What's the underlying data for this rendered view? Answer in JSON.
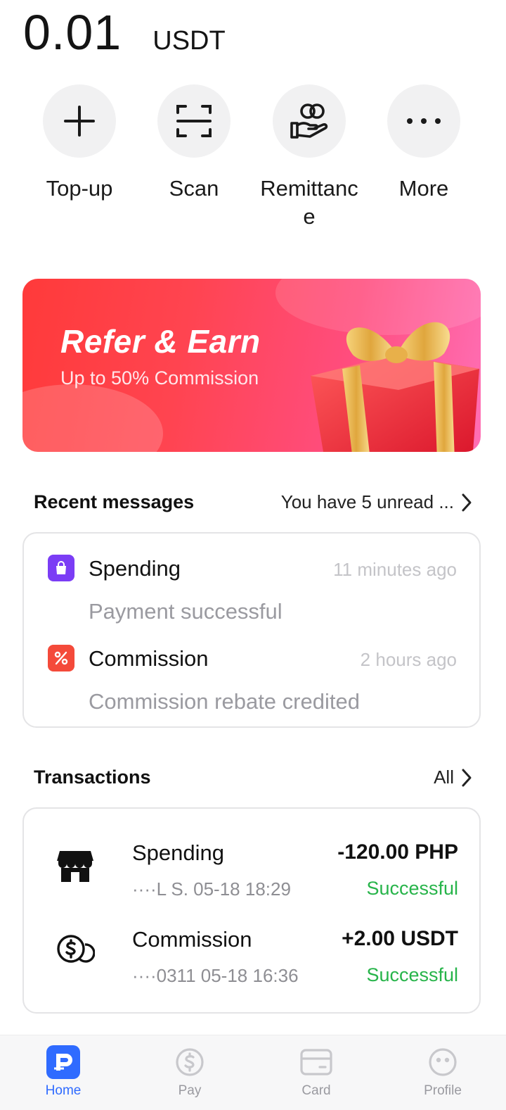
{
  "balance": {
    "amount": "0.01",
    "currency": "USDT"
  },
  "actions": [
    {
      "label": "Top-up",
      "icon": "plus-icon"
    },
    {
      "label": "Scan",
      "icon": "scan-icon"
    },
    {
      "label": "Remittance",
      "icon": "remittance-icon"
    },
    {
      "label": "More",
      "icon": "more-icon"
    }
  ],
  "banner": {
    "title": "Refer & Earn",
    "subtitle": "Up to 50% Commission"
  },
  "messages": {
    "title": "Recent messages",
    "link": "You have 5 unread ...",
    "items": [
      {
        "name": "Spending",
        "time": "11 minutes ago",
        "desc": "Payment successful",
        "icon": "shopping-bag-icon",
        "color": "#7b3df5"
      },
      {
        "name": "Commission",
        "time": "2 hours ago",
        "desc": "Commission rebate credited",
        "icon": "percent-icon",
        "color": "#f44a3a"
      }
    ]
  },
  "transactions": {
    "title": "Transactions",
    "link": "All",
    "items": [
      {
        "name": "Spending",
        "meta": "····L S.  05-18 18:29",
        "amount": "-120.00 PHP",
        "status": "Successful",
        "icon": "store-icon"
      },
      {
        "name": "Commission",
        "meta": "····0311  05-18 16:36",
        "amount": "+2.00 USDT",
        "status": "Successful",
        "icon": "coin-icon"
      }
    ]
  },
  "tabbar": [
    {
      "label": "Home",
      "icon": "home-icon",
      "active": true
    },
    {
      "label": "Pay",
      "icon": "pay-icon",
      "active": false
    },
    {
      "label": "Card",
      "icon": "card-icon",
      "active": false
    },
    {
      "label": "Profile",
      "icon": "profile-icon",
      "active": false
    }
  ],
  "colors": {
    "accent": "#2f6bff",
    "success": "#27b44a"
  }
}
